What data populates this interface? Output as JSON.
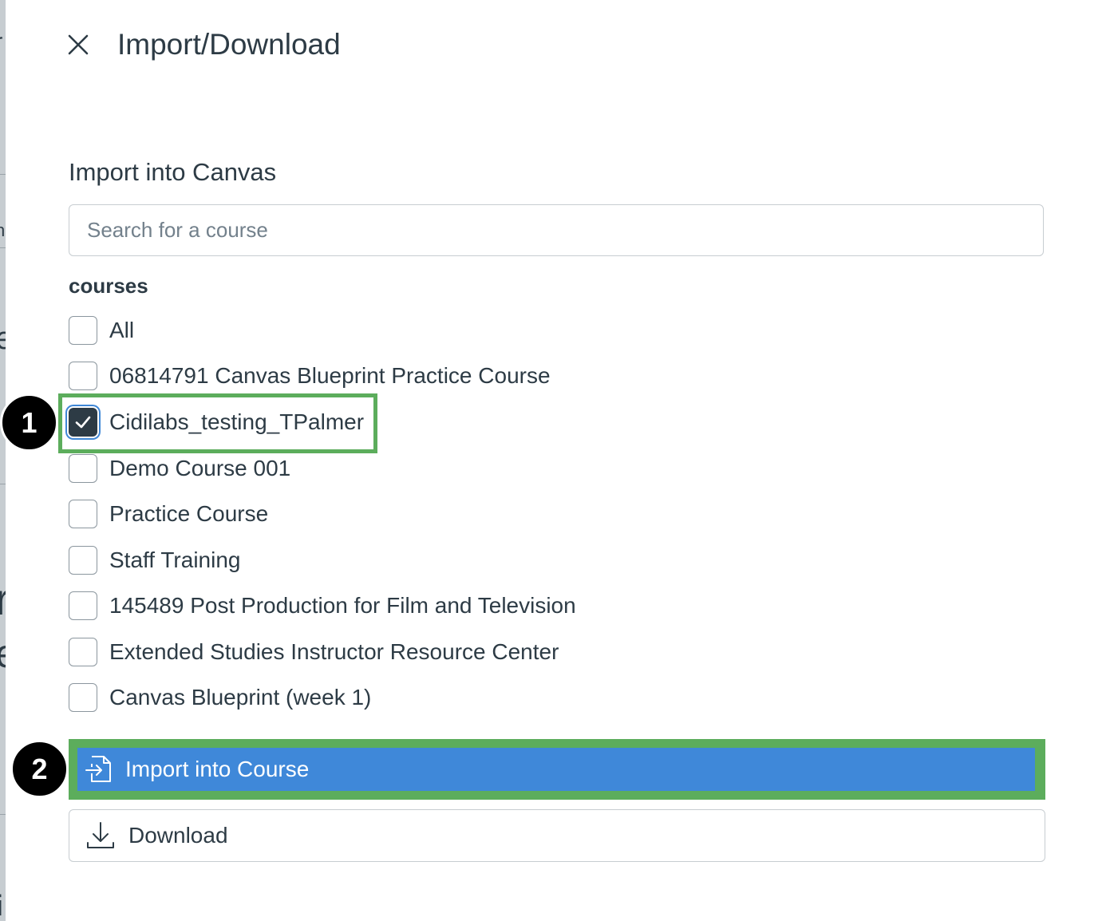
{
  "backdrop": {
    "fragments": [
      "r",
      "n",
      "e",
      "r",
      "e",
      ":",
      "i"
    ]
  },
  "tray": {
    "title": "Import/Download",
    "close_icon": "close-icon",
    "section_heading": "Import into Canvas",
    "search": {
      "placeholder": "Search for a course",
      "value": ""
    },
    "list_label": "courses",
    "courses": [
      {
        "label": "All",
        "checked": false
      },
      {
        "label": "06814791 Canvas Blueprint Practice Course",
        "checked": false
      },
      {
        "label": "Cidilabs_testing_TPalmer",
        "checked": true
      },
      {
        "label": "Demo Course 001",
        "checked": false
      },
      {
        "label": "Practice Course",
        "checked": false
      },
      {
        "label": "Staff Training",
        "checked": false
      },
      {
        "label": "145489 Post Production for Film and Television",
        "checked": false
      },
      {
        "label": "Extended Studies Instructor Resource Center",
        "checked": false
      },
      {
        "label": "Canvas Blueprint (week 1)",
        "checked": false
      }
    ],
    "import_button": {
      "label": "Import into Course",
      "icon": "import-icon"
    },
    "download_button": {
      "label": "Download",
      "icon": "download-icon"
    }
  },
  "annotations": {
    "step1": "1",
    "step2": "2"
  },
  "colors": {
    "text": "#2d3b45",
    "primary": "#3f88d9",
    "highlight": "#5cad5c",
    "checked": "#2d3b45",
    "focus": "#3f87d6"
  }
}
